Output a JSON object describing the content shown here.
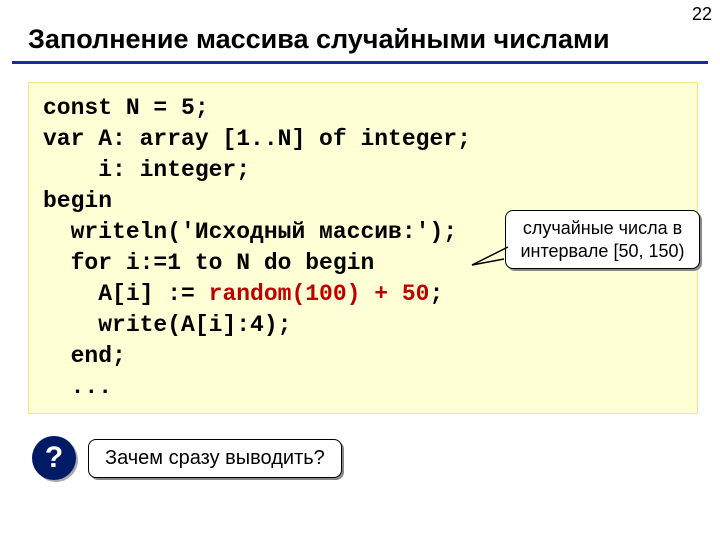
{
  "page_number": "22",
  "title": "Заполнение массива случайными числами",
  "code": {
    "l1": "const N = 5;",
    "l2": "var A: array [1..N] of integer;",
    "l3": "    i: integer;",
    "l4": "begin",
    "l5": "  writeln('Исходный массив:');",
    "l6_a": "  for i:=1 to N do begin",
    "l7_a": "    A[i] := ",
    "l7_red": "random(100) + 50",
    "l7_b": ";",
    "l8": "    write(A[i]:4);",
    "l9": "  end;",
    "l10": "  ..."
  },
  "callout": {
    "line1": "случайные числа в",
    "line2": "интервале [50, 150)"
  },
  "question": {
    "badge": "?",
    "text": "Зачем сразу выводить?"
  }
}
